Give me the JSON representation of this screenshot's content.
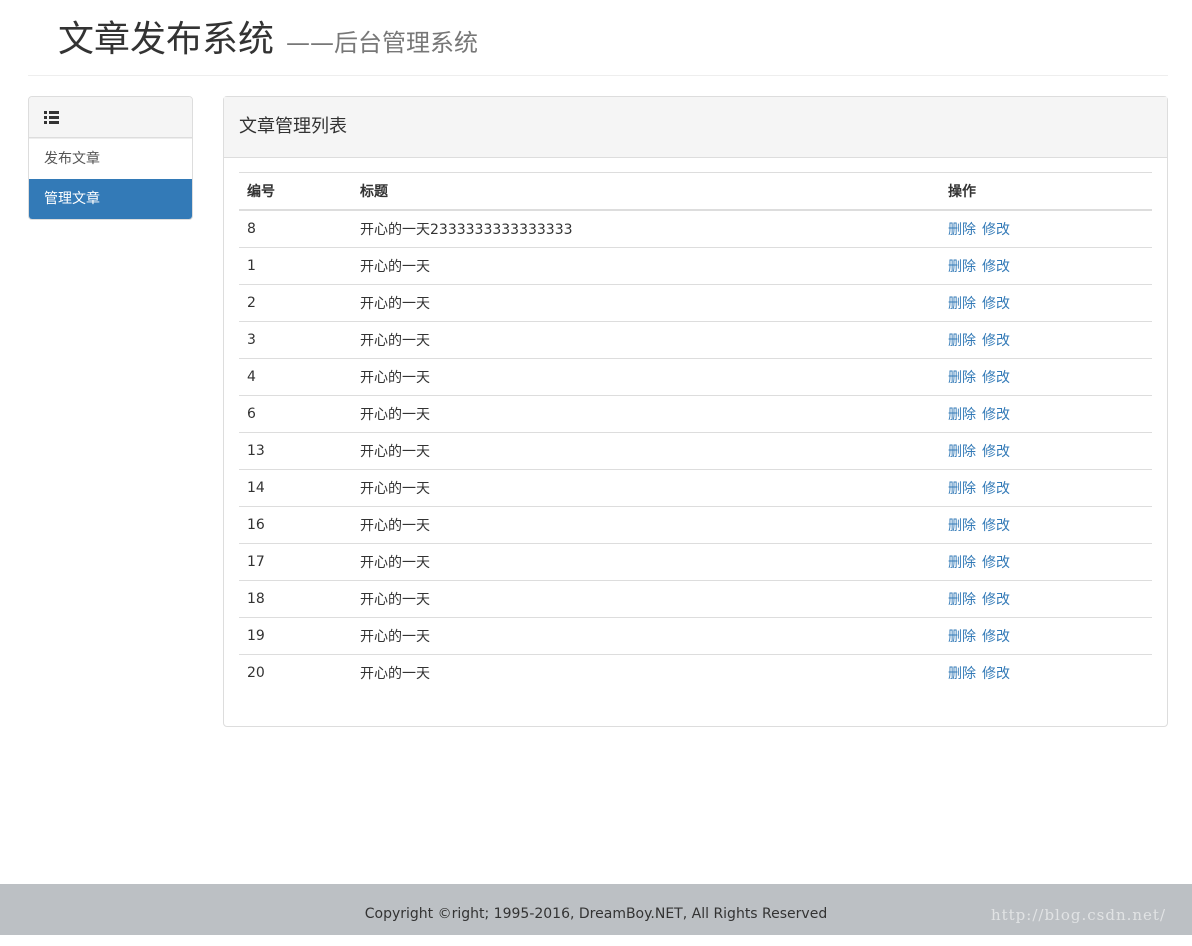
{
  "header": {
    "title": "文章发布系统",
    "subtitle": "——后台管理系统"
  },
  "sidebar": {
    "icon": "list-icon",
    "items": [
      {
        "label": "发布文章",
        "active": false
      },
      {
        "label": "管理文章",
        "active": true
      }
    ]
  },
  "panel": {
    "title": "文章管理列表",
    "columns": [
      "编号",
      "标题",
      "操作"
    ],
    "delete_label": "删除",
    "edit_label": "修改",
    "rows": [
      {
        "id": "8",
        "title": "开心的一天2333333333333333"
      },
      {
        "id": "1",
        "title": "开心的一天"
      },
      {
        "id": "2",
        "title": "开心的一天"
      },
      {
        "id": "3",
        "title": "开心的一天"
      },
      {
        "id": "4",
        "title": "开心的一天"
      },
      {
        "id": "6",
        "title": "开心的一天"
      },
      {
        "id": "13",
        "title": "开心的一天"
      },
      {
        "id": "14",
        "title": "开心的一天"
      },
      {
        "id": "16",
        "title": "开心的一天"
      },
      {
        "id": "17",
        "title": "开心的一天"
      },
      {
        "id": "18",
        "title": "开心的一天"
      },
      {
        "id": "19",
        "title": "开心的一天"
      },
      {
        "id": "20",
        "title": "开心的一天"
      }
    ]
  },
  "footer": {
    "text": "Copyright ©right; 1995-2016, DreamBoy.NET, All Rights Reserved",
    "watermark": "http://blog.csdn.net/"
  },
  "colors": {
    "primary": "#337ab7",
    "footer_bg": "#bcc0c4",
    "panel_heading_bg": "#f5f5f5"
  }
}
